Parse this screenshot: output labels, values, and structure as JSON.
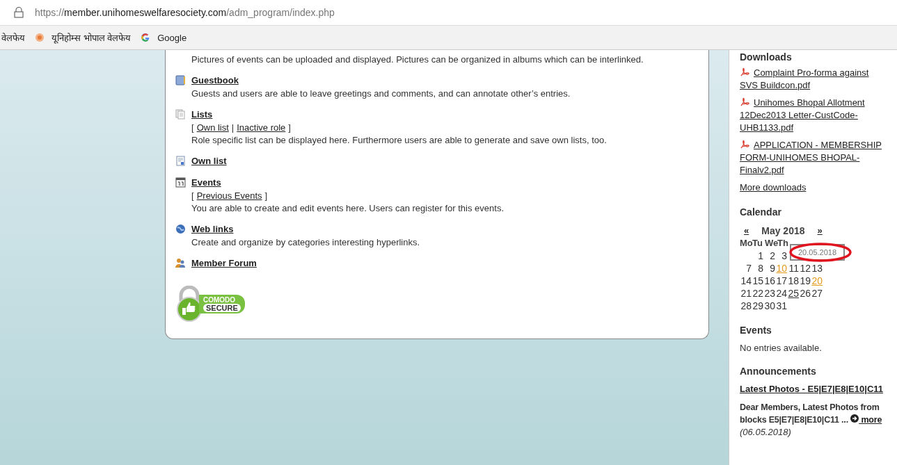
{
  "browser": {
    "url_scheme": "https://",
    "url_host": "member.unihomeswelfaresociety.com",
    "url_path": "/adm_program/index.php",
    "bookmarks": [
      {
        "label": "वेलफेय",
        "kind": "plain"
      },
      {
        "label": "यूनिहोम्स भोपाल वेलफेय",
        "kind": "flower"
      },
      {
        "label": "Google",
        "kind": "google"
      }
    ]
  },
  "modules": [
    {
      "kind": "plain",
      "description": "Pictures of events can be uploaded and displayed. Pictures can be organized in albums which can be interlinked."
    },
    {
      "kind": "book",
      "title": "Guestbook",
      "description": "Guests and users are able to leave greetings and comments, and can annotate other’s entries."
    },
    {
      "kind": "pages",
      "title": "Lists",
      "links": {
        "open": "[",
        "items": [
          "Own list",
          "Inactive role"
        ],
        "separator": "|",
        "close": "]"
      },
      "description": "Role specific list can be displayed here. Furthermore users are able to generate and save own lists, too."
    },
    {
      "kind": "document",
      "title": "Own list"
    },
    {
      "kind": "calendar",
      "title": "Events",
      "links": {
        "open": "[",
        "items": [
          "Previous Events"
        ],
        "close": "]"
      },
      "description": "You are able to create and edit events here. Users can register for this events."
    },
    {
      "kind": "globe",
      "title": "Web links",
      "description": "Create and organize by categories interesting hyperlinks."
    },
    {
      "kind": "people",
      "title": "Member Forum"
    }
  ],
  "secure_badge": {
    "line_1": "COMODO",
    "line_2": "SECURE"
  },
  "sidebar": {
    "downloads": {
      "heading": "Downloads",
      "files": [
        "Complaint Pro-forma against SVS Buildcon.pdf",
        "Unihomes Bhopal Allotment 12Dec2013 Letter-CustCode-UHB1133.pdf",
        "APPLICATION - MEMBERSHIP FORM-UNIHOMES BHOPAL-Finalv2.pdf"
      ],
      "more": "More downloads"
    },
    "calendar": {
      "heading": "Calendar",
      "prev": "«",
      "month": "May 2018",
      "next": "»",
      "weekdays": [
        "Mo",
        "Tu",
        "We",
        "Th"
      ],
      "weeks": [
        [
          {
            "kind": "blank"
          },
          {
            "day": "1",
            "event": false,
            "today": false
          },
          {
            "day": "2",
            "event": false,
            "today": false
          },
          {
            "day": "3",
            "event": false,
            "today": false
          }
        ],
        [
          {
            "day": "7",
            "event": false,
            "today": false
          },
          {
            "day": "8",
            "event": false,
            "today": false
          },
          {
            "day": "9",
            "event": false,
            "today": false
          },
          {
            "day": "10",
            "event": true,
            "today": false
          },
          {
            "day": "11",
            "event": false,
            "today": false
          },
          {
            "day": "12",
            "event": false,
            "today": false
          },
          {
            "day": "13",
            "event": false,
            "today": false
          }
        ],
        [
          {
            "day": "14",
            "event": false,
            "today": false
          },
          {
            "day": "15",
            "event": false,
            "today": false
          },
          {
            "day": "16",
            "event": false,
            "today": false
          },
          {
            "day": "17",
            "event": false,
            "today": false
          },
          {
            "day": "18",
            "event": false,
            "today": false
          },
          {
            "day": "19",
            "event": false,
            "today": false
          },
          {
            "day": "20",
            "event": true,
            "today": false
          }
        ],
        [
          {
            "day": "21",
            "event": false,
            "today": false
          },
          {
            "day": "22",
            "event": false,
            "today": false
          },
          {
            "day": "23",
            "event": false,
            "today": false
          },
          {
            "day": "24",
            "event": false,
            "today": false
          },
          {
            "day": "25",
            "event": false,
            "today": true
          },
          {
            "day": "26",
            "event": false,
            "today": false
          },
          {
            "day": "27",
            "event": false,
            "today": false
          }
        ],
        [
          {
            "day": "28",
            "event": false,
            "today": false
          },
          {
            "day": "29",
            "event": false,
            "today": false
          },
          {
            "day": "30",
            "event": false,
            "today": false
          },
          {
            "day": "31",
            "event": false,
            "today": false
          }
        ]
      ],
      "tooltip": "20.05.2018"
    },
    "events": {
      "heading": "Events",
      "text": "No entries available."
    },
    "announcements": {
      "heading": "Announcements",
      "title": "Latest Photos - E5|E7|E8|E10|C11",
      "text": "Dear Members, Latest Photos from blocks E5|E7|E8|E10|C11 ...",
      "more": "more",
      "date": "(06.05.2018)"
    }
  }
}
